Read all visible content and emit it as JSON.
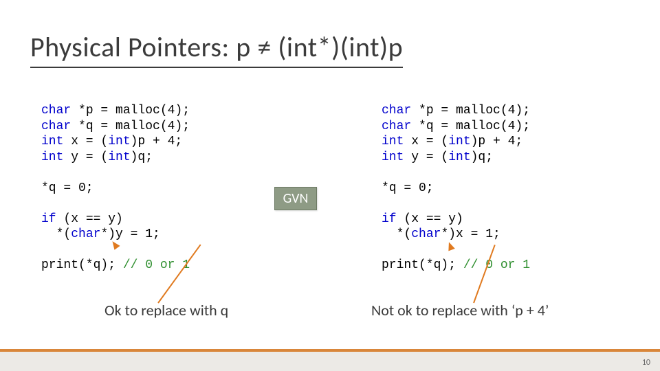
{
  "title_text": "Physical Pointers: p ≠ (int*)(int)p",
  "gvn_label": "GVN",
  "caption_left": "Ok to replace with q",
  "caption_right": "Not ok to replace with ‘p + 4’",
  "page_number": "10",
  "left_code": {
    "l1a": "char",
    "l1b": " *p = malloc(4);",
    "l2a": "char",
    "l2b": " *q = malloc(4);",
    "l3a": "int",
    "l3b": " x = (",
    "l3c": "int",
    "l3d": ")p + 4;",
    "l4a": "int",
    "l4b": " y = (",
    "l4c": "int",
    "l4d": ")q;",
    "l5": "",
    "l6": "*q = 0;",
    "l7": "",
    "l8a": "if",
    "l8b": " (x == y)",
    "l9a": "  *(",
    "l9b": "char",
    "l9c": "*)y = 1;",
    "l10": "",
    "l11a": "print(*q); ",
    "l11b": "// 0 or 1"
  },
  "right_code": {
    "l1a": "char",
    "l1b": " *p = malloc(4);",
    "l2a": "char",
    "l2b": " *q = malloc(4);",
    "l3a": "int",
    "l3b": " x = (",
    "l3c": "int",
    "l3d": ")p + 4;",
    "l4a": "int",
    "l4b": " y = (",
    "l4c": "int",
    "l4d": ")q;",
    "l5": "",
    "l6": "*q = 0;",
    "l7": "",
    "l8a": "if",
    "l8b": " (x == y)",
    "l9a": "  *(",
    "l9b": "char",
    "l9c": "*)x = 1;",
    "l10": "",
    "l11a": "print(*q); ",
    "l11b": "// 0 or 1"
  }
}
